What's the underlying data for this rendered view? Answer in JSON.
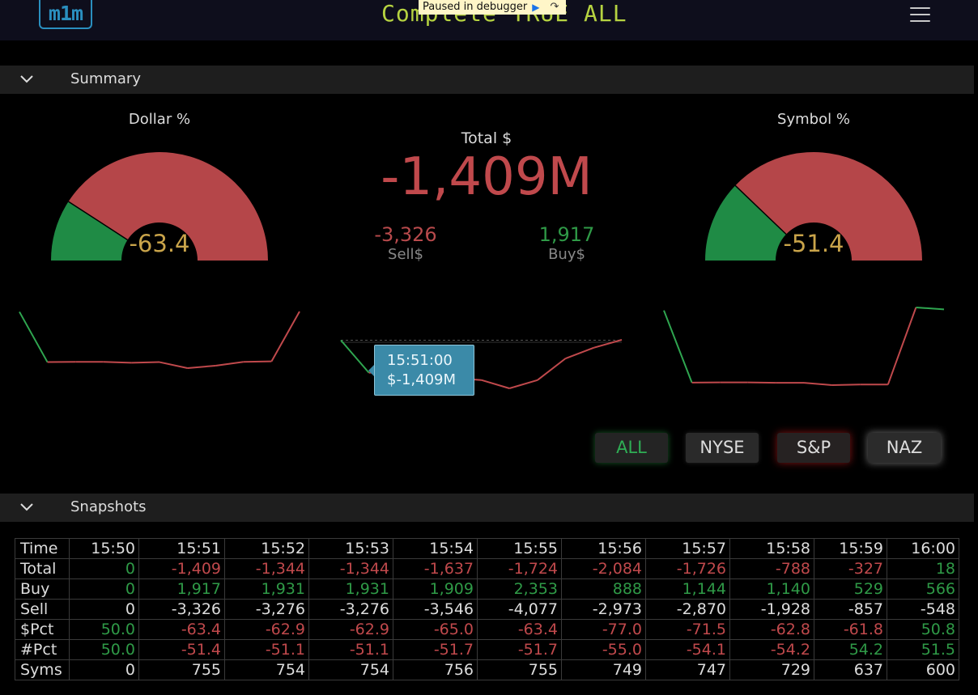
{
  "header": {
    "logo_text": "m1m",
    "title": "Complete  TRUE  ALL",
    "debug_banner": "Paused in debugger"
  },
  "summary": {
    "section_title": "Summary",
    "dollar_gauge": {
      "title": "Dollar %",
      "value": "-63.4",
      "pct": -63.4
    },
    "symbol_gauge": {
      "title": "Symbol %",
      "value": "-51.4",
      "pct": -51.4
    },
    "total": {
      "label": "Total $",
      "value": "-1,409M"
    },
    "sell": {
      "label": "Sell$",
      "value": "-3,326"
    },
    "buy": {
      "label": "Buy$",
      "value": "1,917"
    },
    "tooltip": {
      "time": "15:51:00",
      "value": "$-1,409M"
    },
    "spark_dollar_pct": [
      50.0,
      -63.4,
      -62.9,
      -62.9,
      -65.0,
      -63.4,
      -77.0,
      -71.5,
      -62.8,
      -61.8,
      50.8
    ],
    "spark_total": [
      0,
      -1409,
      -1344,
      -1344,
      -1637,
      -1724,
      -2084,
      -1726,
      -788,
      -327,
      18
    ],
    "spark_symbol_pct": [
      50.0,
      -51.4,
      -51.1,
      -51.1,
      -51.7,
      -51.7,
      -55.0,
      -54.1,
      -54.2,
      54.2,
      51.5
    ],
    "exchange_buttons": [
      "ALL",
      "NYSE",
      "S&P",
      "NAZ"
    ]
  },
  "snapshots": {
    "section_title": "Snapshots",
    "columns": [
      "Time",
      "15:50",
      "15:51",
      "15:52",
      "15:53",
      "15:54",
      "15:55",
      "15:56",
      "15:57",
      "15:58",
      "15:59",
      "16:00"
    ],
    "rows": [
      {
        "label": "Total",
        "values": [
          "0",
          "-1,409",
          "-1,344",
          "-1,344",
          "-1,637",
          "-1,724",
          "-2,084",
          "-1,726",
          "-788",
          "-327",
          "18"
        ]
      },
      {
        "label": "Buy",
        "values": [
          "0",
          "1,917",
          "1,931",
          "1,931",
          "1,909",
          "2,353",
          "888",
          "1,144",
          "1,140",
          "529",
          "566"
        ]
      },
      {
        "label": "Sell",
        "values": [
          "0",
          "-3,326",
          "-3,276",
          "-3,276",
          "-3,546",
          "-4,077",
          "-2,973",
          "-2,870",
          "-1,928",
          "-857",
          "-548"
        ]
      },
      {
        "label": "$Pct",
        "values": [
          "50.0",
          "-63.4",
          "-62.9",
          "-62.9",
          "-65.0",
          "-63.4",
          "-77.0",
          "-71.5",
          "-62.8",
          "-61.8",
          "50.8"
        ]
      },
      {
        "label": "#Pct",
        "values": [
          "50.0",
          "-51.4",
          "-51.1",
          "-51.1",
          "-51.7",
          "-51.7",
          "-55.0",
          "-54.1",
          "-54.2",
          "54.2",
          "51.5"
        ]
      },
      {
        "label": "Syms",
        "values": [
          "0",
          "755",
          "754",
          "754",
          "756",
          "755",
          "749",
          "747",
          "729",
          "637",
          "600"
        ]
      }
    ]
  },
  "colors": {
    "positive": "#2f9a47",
    "negative": "#c0494c",
    "gauge_value": "#c9a44a",
    "accent": "#3b8aa8"
  }
}
